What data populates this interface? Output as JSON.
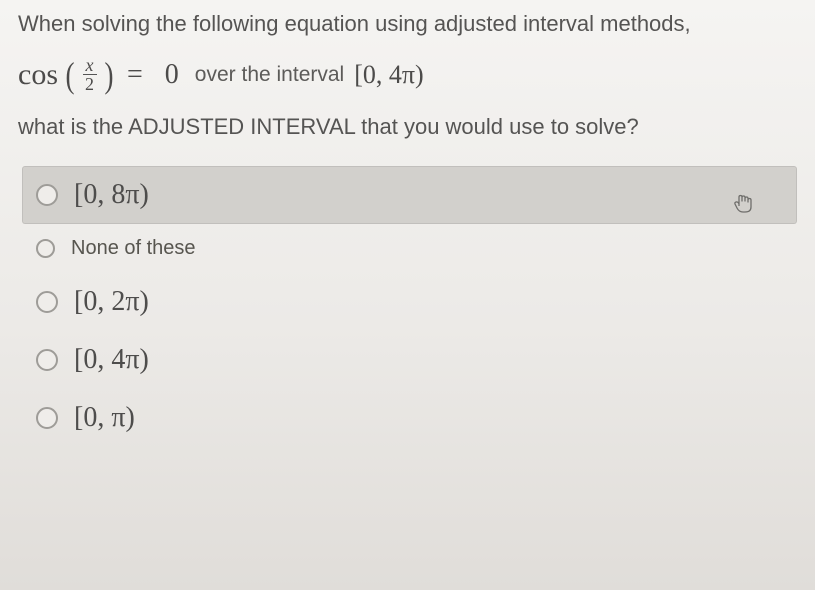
{
  "question": {
    "line1": "When solving the following equation using adjusted interval methods,",
    "line2_suffix": "what is the ADJUSTED INTERVAL that you would use to solve?"
  },
  "equation": {
    "func": "cos",
    "frac_num": "x",
    "frac_den": "2",
    "equals": "=",
    "rhs": "0",
    "over_text": "over the interval",
    "interval": "[0, 4π)"
  },
  "options": [
    {
      "label": "[0, 8π)",
      "hovered": true
    },
    {
      "label": "None of these",
      "hovered": false
    },
    {
      "label": "[0, 2π)",
      "hovered": false
    },
    {
      "label": "[0, 4π)",
      "hovered": false
    },
    {
      "label": "[0, π)",
      "hovered": false
    }
  ]
}
